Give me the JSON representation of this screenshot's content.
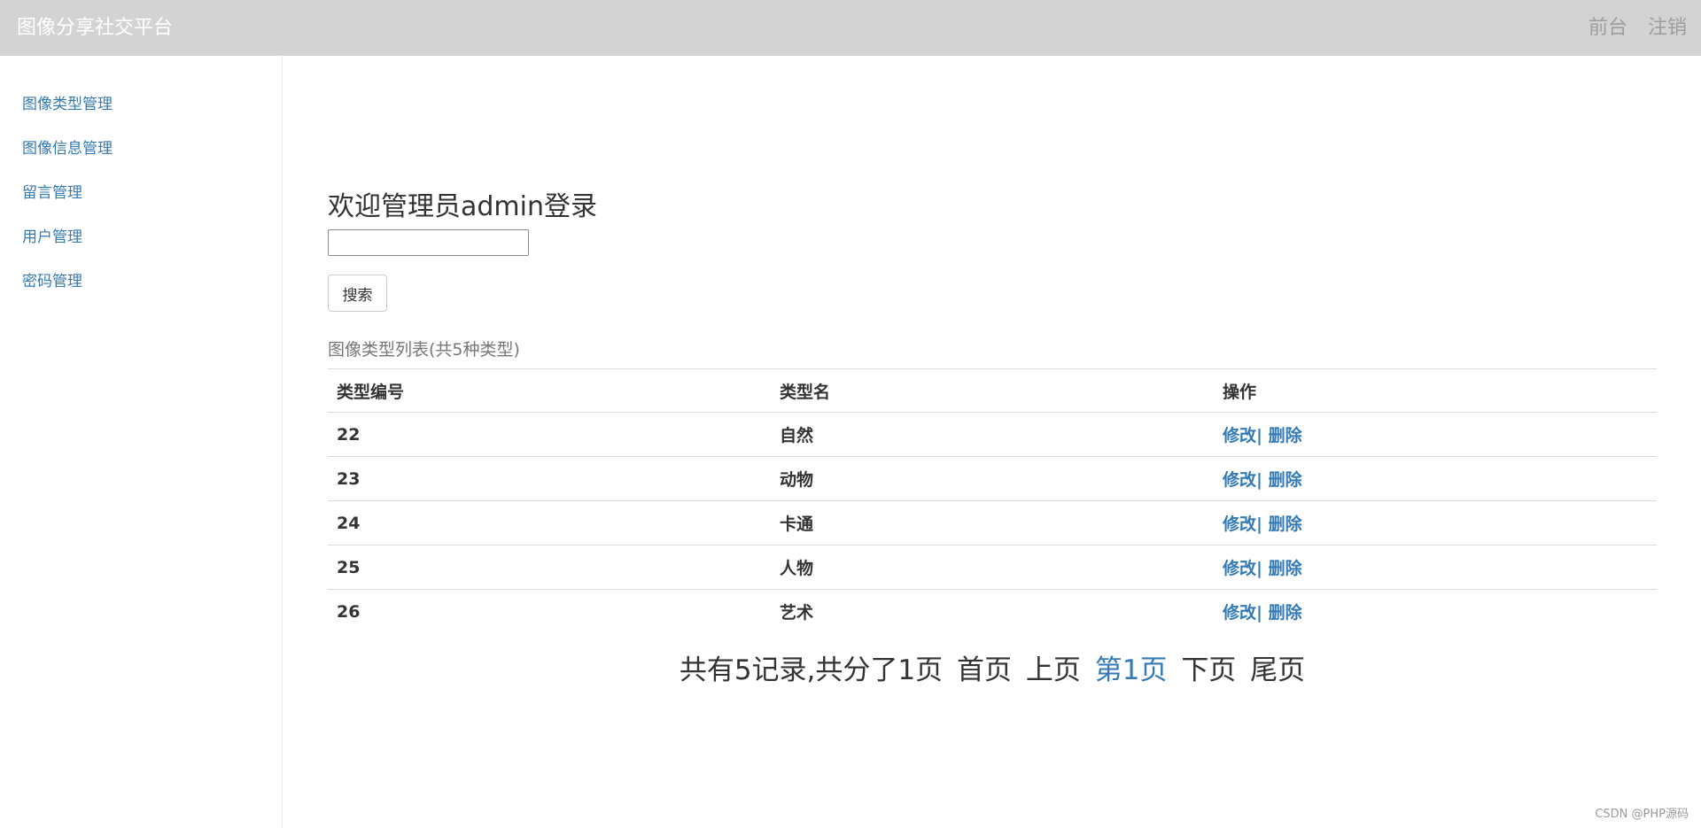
{
  "header": {
    "brand": "图像分享社交平台",
    "links": [
      "前台",
      "注销"
    ]
  },
  "sidebar": {
    "items": [
      {
        "label": "图像类型管理"
      },
      {
        "label": "图像信息管理"
      },
      {
        "label": "留言管理"
      },
      {
        "label": "用户管理"
      },
      {
        "label": "密码管理"
      }
    ]
  },
  "main": {
    "welcome": "欢迎管理员admin登录",
    "search": {
      "value": "",
      "button_label": "搜索"
    },
    "caption": "图像类型列表(共5种类型)",
    "table": {
      "headers": [
        "类型编号",
        "类型名",
        "操作"
      ],
      "edit_label": "修改",
      "separator": "|",
      "delete_label": "删除",
      "rows": [
        {
          "id": "22",
          "name": "自然"
        },
        {
          "id": "23",
          "name": "动物"
        },
        {
          "id": "24",
          "name": "卡通"
        },
        {
          "id": "25",
          "name": "人物"
        },
        {
          "id": "26",
          "name": "艺术"
        }
      ]
    },
    "pager": {
      "summary": "共有5记录,共分了1页",
      "first": "首页",
      "prev": "上页",
      "current": "第1页",
      "next": "下页",
      "last": "尾页"
    }
  },
  "watermark": "CSDN @PHP源码"
}
